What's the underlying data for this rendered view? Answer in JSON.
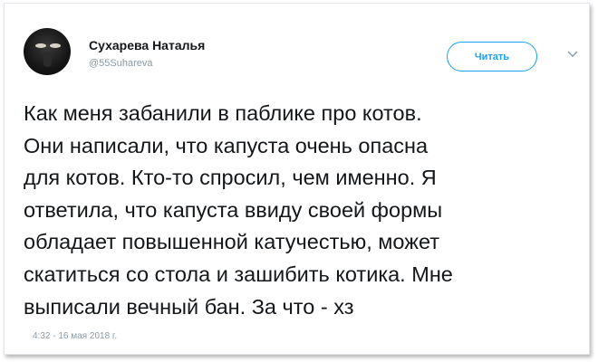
{
  "author": {
    "name": "Сухарева Наталья",
    "handle": "@55Suhareva"
  },
  "follow_button": {
    "label": "Читать"
  },
  "menu_icon": "chevron-down-icon",
  "tweet": {
    "lines": [
      "Как меня забанили в паблике про котов.",
      "Они написали, что капуста очень опасна",
      "для котов. Кто-то спросил, чем именно. Я",
      "ответила, что капуста ввиду своей формы",
      "обладает повышенной катучестью, может",
      "скатиться со стола и зашибить котика. Мне",
      "выписали вечный бан. За что - хз"
    ],
    "timestamp": "4:32 - 16 мая 2018 г."
  },
  "colors": {
    "accent": "#1da1f2",
    "text": "#14171a",
    "muted": "#8899a6"
  }
}
